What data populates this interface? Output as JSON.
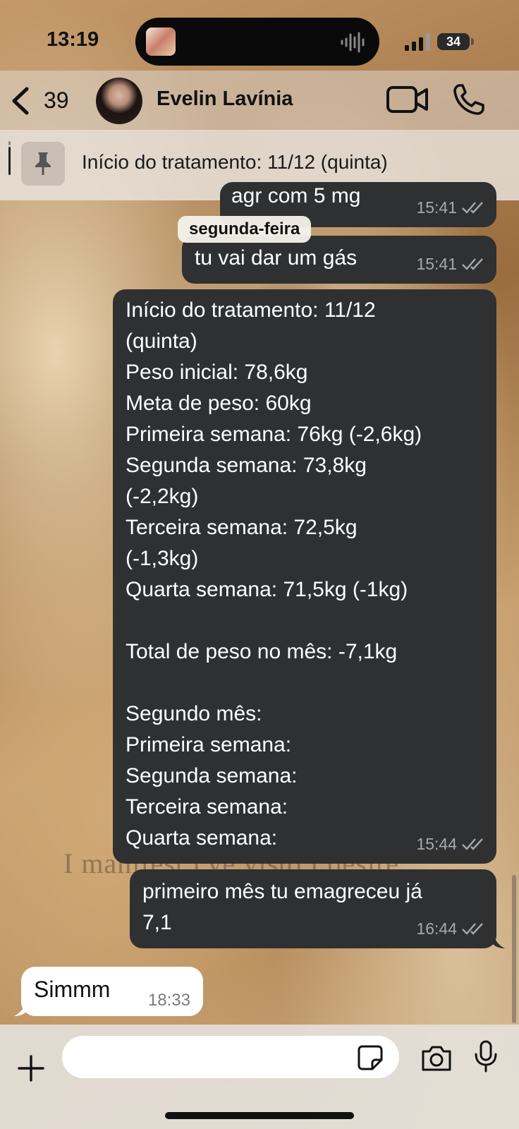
{
  "status_bar": {
    "time": "13:19",
    "battery": "34"
  },
  "header": {
    "back_count": "39",
    "contact_name": "Evelin Lavínia"
  },
  "pinned": {
    "text": "Início do tratamento: 11/12 (quinta)"
  },
  "messages": {
    "partial": {
      "text": "agr com 5 mg",
      "time": "15:41"
    },
    "day_label": "segunda-feira",
    "gas": {
      "text": "tu vai dar um gás",
      "time": "15:41"
    },
    "summary": {
      "lines": [
        "Início do tratamento: 11/12",
        "(quinta)",
        "Peso inicial: 78,6kg",
        "Meta de peso: 60kg",
        "Primeira semana: 76kg (-2,6kg)",
        "Segunda semana: 73,8kg",
        "(-2,2kg)",
        "Terceira semana: 72,5kg",
        "(-1,3kg)",
        "Quarta semana: 71,5kg (-1kg)",
        "",
        "Total de peso no mês: -7,1kg",
        "",
        "Segundo mês:",
        "Primeira semana:",
        "Segunda semana:",
        "Terceira semana:",
        "Quarta semana:"
      ],
      "time": "15:44"
    },
    "first_month": {
      "lines": [
        "primeiro mês tu emagreceu já",
        "7,1"
      ],
      "time": "16:44"
    },
    "incoming": {
      "text": "Simmm",
      "time": "18:33"
    }
  },
  "wallpaper_text": "I manifest I've visto I desire",
  "composer": {
    "placeholder": ""
  },
  "icons": {
    "back": "chevron-left",
    "video": "video-camera",
    "phone": "phone",
    "pin": "pushpin",
    "plus": "plus",
    "sticker": "sticker",
    "camera": "camera",
    "mic": "microphone",
    "read_receipt": "double-check"
  }
}
